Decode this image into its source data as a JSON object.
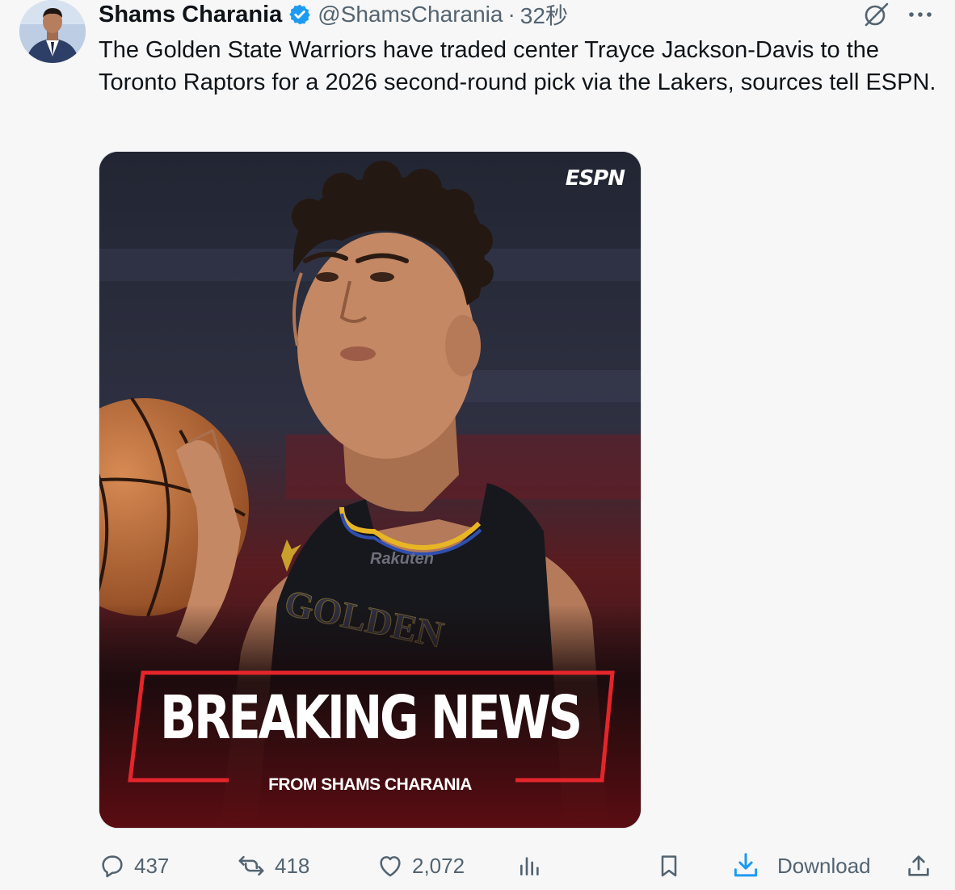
{
  "author": {
    "display_name": "Shams Charania",
    "handle": "@ShamsCharania",
    "separator": "·",
    "time": "32秒"
  },
  "tweet": {
    "text": "The Golden State Warriors have traded center Trayce Jackson-Davis to the Toronto Raptors for a 2026 second-round pick via the Lakers, sources tell ESPN."
  },
  "media": {
    "logo": "ESPN",
    "jersey_sponsor": "Rakuten",
    "jersey_text": "GOLDEN",
    "headline": "BREAKING NEWS",
    "subline": "FROM SHAMS CHARANIA"
  },
  "actions": {
    "replies": "437",
    "reposts": "418",
    "likes": "2,072",
    "download_label": "Download"
  },
  "icons": {
    "verified": "verified-badge-icon",
    "grok": "grok-icon",
    "more": "more-icon",
    "reply": "reply-icon",
    "repost": "repost-icon",
    "like": "like-icon",
    "views": "views-icon",
    "bookmark": "bookmark-icon",
    "download": "download-icon",
    "share": "share-icon"
  },
  "colors": {
    "verified": "#1d9bf0",
    "download_accent": "#1d9bf0",
    "breaking_red": "#e4252b",
    "text_primary": "#0f1419",
    "text_secondary": "#536471"
  }
}
